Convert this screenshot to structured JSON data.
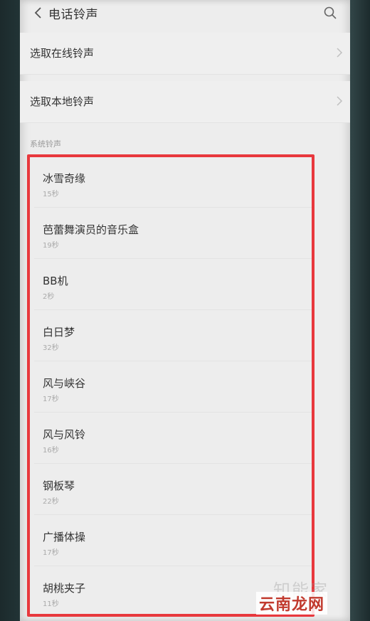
{
  "header": {
    "title": "电话铃声"
  },
  "menu": [
    {
      "label": "选取在线铃声"
    },
    {
      "label": "选取本地铃声"
    }
  ],
  "section": {
    "label": "系统铃声"
  },
  "ringtones": [
    {
      "name": "冰雪奇缘",
      "duration": "15秒"
    },
    {
      "name": "芭蕾舞演员的音乐盒",
      "duration": "19秒"
    },
    {
      "name": "BB机",
      "duration": "2秒"
    },
    {
      "name": "白日梦",
      "duration": "32秒"
    },
    {
      "name": "风与峡谷",
      "duration": "17秒"
    },
    {
      "name": "风与风铃",
      "duration": "16秒"
    },
    {
      "name": "钢板琴",
      "duration": "22秒"
    },
    {
      "name": "广播体操",
      "duration": "17秒"
    },
    {
      "name": "胡桃夹子",
      "duration": "11秒"
    }
  ],
  "watermark": {
    "faint": "知能家",
    "main": "云南龙网"
  },
  "colors": {
    "highlight": "#e8383d",
    "watermark": "#c13a2e"
  }
}
